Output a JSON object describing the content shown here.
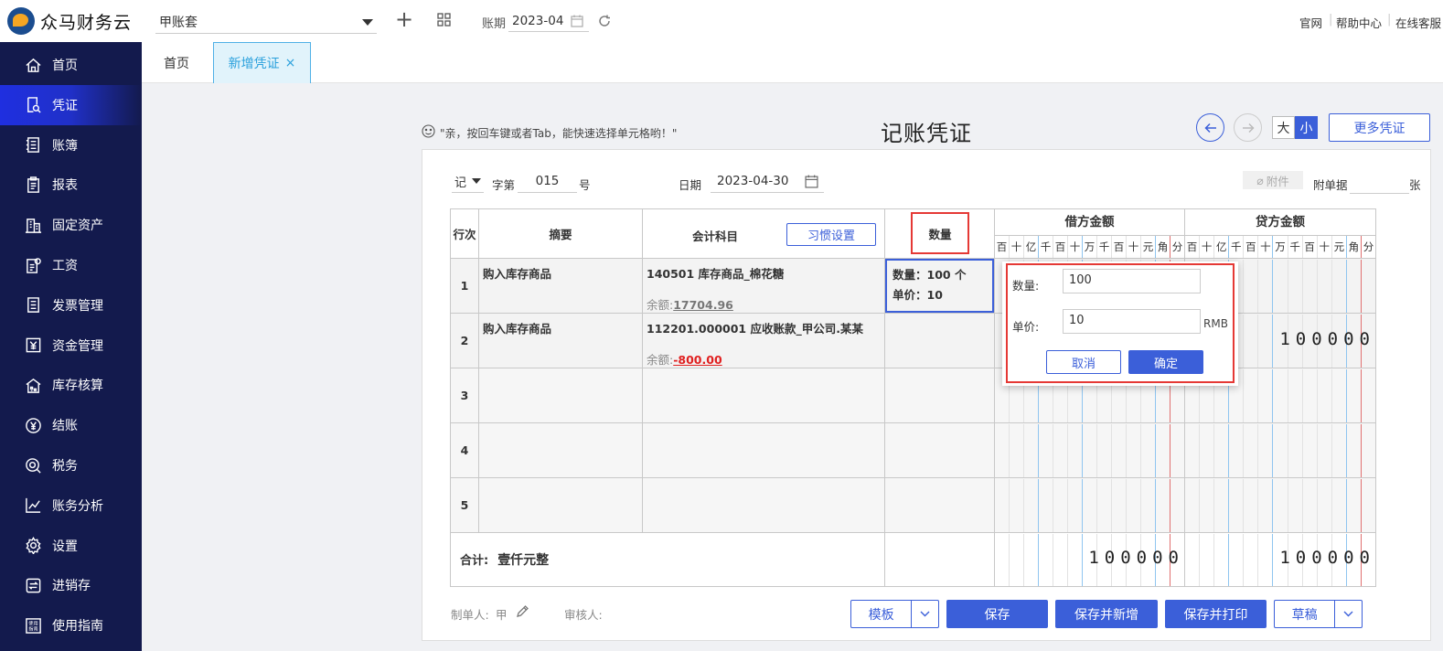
{
  "brand": {
    "name": "众马财务云"
  },
  "sidebar": {
    "items": [
      {
        "label": "首页",
        "icon": "home-icon"
      },
      {
        "label": "凭证",
        "icon": "voucher-search-icon",
        "active": true
      },
      {
        "label": "账簿",
        "icon": "ledger-icon"
      },
      {
        "label": "报表",
        "icon": "report-icon"
      },
      {
        "label": "固定资产",
        "icon": "building-icon"
      },
      {
        "label": "工资",
        "icon": "salary-icon"
      },
      {
        "label": "发票管理",
        "icon": "invoice-icon"
      },
      {
        "label": "资金管理",
        "icon": "yen-box-icon"
      },
      {
        "label": "库存核算",
        "icon": "warehouse-icon"
      },
      {
        "label": "结账",
        "icon": "yen-circle-icon"
      },
      {
        "label": "税务",
        "icon": "tax-icon"
      },
      {
        "label": "账务分析",
        "icon": "chart-line-icon"
      },
      {
        "label": "设置",
        "icon": "gear-icon"
      },
      {
        "label": "进销存",
        "icon": "swap-icon"
      },
      {
        "label": "使用指南",
        "icon": "guide-icon"
      }
    ]
  },
  "topbar": {
    "account_set": "甲账套",
    "period_label": "账期",
    "period_value": "2023-04",
    "links": [
      "官网",
      "帮助中心",
      "在线客服"
    ]
  },
  "tabs": [
    {
      "label": "首页"
    },
    {
      "label": "新增凭证",
      "active": true,
      "close": "×"
    }
  ],
  "hint": "\"亲，按回车键或者Tab，能快速选择单元格哟！\"",
  "voucher": {
    "title": "记账凭证",
    "size_big": "大",
    "size_small": "小",
    "more_label": "更多凭证",
    "word": "记",
    "word_label": "字第",
    "number": "015",
    "number_suffix": "号",
    "date_label": "日期",
    "date": "2023-04-30",
    "attach_label": "附件",
    "attach_doc_label": "附单据",
    "attach_unit": "张",
    "headers": {
      "row": "行次",
      "summary": "摘要",
      "subject": "会计科目",
      "habit_btn": "习惯设置",
      "qty": "数量",
      "debit": "借方金额",
      "credit": "贷方金额"
    },
    "digits": [
      "百",
      "十",
      "亿",
      "千",
      "百",
      "十",
      "万",
      "千",
      "百",
      "十",
      "元",
      "角",
      "分"
    ],
    "rows": [
      {
        "no": "1",
        "summary": "购入库存商品",
        "subject": "140501 库存商品_棉花糖",
        "balance_label": "余额:",
        "balance": "17704.96",
        "qty_text": "数量：100 个",
        "price_text": "单价：10",
        "debit": "",
        "credit": ""
      },
      {
        "no": "2",
        "summary": "购入库存商品",
        "subject": "112201.000001 应收账款_甲公司.某某",
        "balance_label": "余额:",
        "balance": "-800.00",
        "qty_text": "",
        "price_text": "",
        "debit": "",
        "credit": "100000"
      },
      {
        "no": "3",
        "summary": "",
        "subject": "",
        "balance_label": "",
        "balance": "",
        "qty_text": "",
        "price_text": "",
        "debit": "",
        "credit": ""
      },
      {
        "no": "4",
        "summary": "",
        "subject": "",
        "balance_label": "",
        "balance": "",
        "qty_text": "",
        "price_text": "",
        "debit": "",
        "credit": ""
      },
      {
        "no": "5",
        "summary": "",
        "subject": "",
        "balance_label": "",
        "balance": "",
        "qty_text": "",
        "price_text": "",
        "debit": "",
        "credit": ""
      }
    ],
    "total_label": "合计:",
    "total_words": "壹仟元整",
    "total_debit": "100000",
    "total_credit": "100000",
    "maker_label": "制单人:",
    "maker": "甲",
    "auditor_label": "审核人:"
  },
  "popup": {
    "qty_label": "数量:",
    "qty_value": "100",
    "price_label": "单价:",
    "price_value": "10",
    "currency": "RMB",
    "cancel": "取消",
    "ok": "确定"
  },
  "actions": {
    "template": "模板",
    "save": "保存",
    "save_new": "保存并新增",
    "save_print": "保存并打印",
    "draft": "草稿"
  },
  "colors": {
    "sidebar_bg": "#131a4d",
    "active": "#1f2fe0",
    "primary": "#3b5fd9",
    "highlight": "#e53935"
  }
}
